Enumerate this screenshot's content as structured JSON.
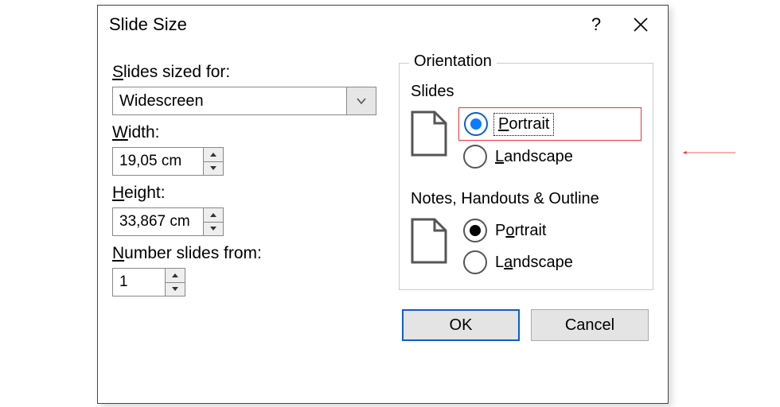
{
  "dialog": {
    "title": "Slide Size",
    "help": "?"
  },
  "left": {
    "sized_for_label_pre": "S",
    "sized_for_label_post": "lides sized for:",
    "sized_for_value": "Widescreen",
    "width_label_pre": "W",
    "width_label_post": "idth:",
    "width_value": "19,05 cm",
    "height_label_pre": "H",
    "height_label_post": "eight:",
    "height_value": "33,867 cm",
    "number_label_pre": "N",
    "number_label_post": "umber slides from:",
    "number_value": "1"
  },
  "orientation": {
    "legend": "Orientation",
    "slides": {
      "title": "Slides",
      "portrait_pre": "P",
      "portrait_post": "ortrait",
      "landscape_pre": "L",
      "landscape_post": "andscape",
      "selected": "portrait"
    },
    "notes": {
      "title": "Notes, Handouts & Outline",
      "portrait_pre": "o",
      "portrait_pre_text": "P",
      "portrait_post": "rtrait",
      "landscape_pre": "a",
      "landscape_pre_text": "L",
      "landscape_post": "ndscape",
      "selected": "portrait"
    }
  },
  "footer": {
    "ok": "OK",
    "cancel": "Cancel"
  }
}
